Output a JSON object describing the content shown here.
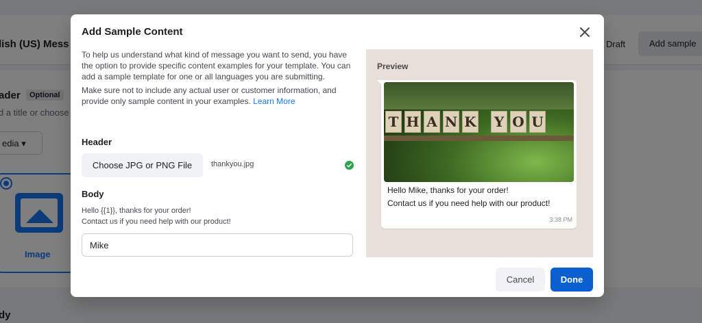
{
  "background": {
    "page_title": "lish (US) Mess",
    "draft_label": "Draft",
    "add_sample_label": "Add sample",
    "header_label": "ader",
    "optional_badge": "Optional",
    "header_hint": "d a title or choose",
    "media_dropdown": "edia",
    "image_option_label": "Image",
    "body_label": "dy"
  },
  "modal": {
    "title": "Add Sample Content",
    "intro": "To help us understand what kind of message you want to send, you have the option to provide specific content examples for your template. You can add a sample template for one or all languages you are submitting.",
    "notice": "Make sure not to include any actual user or customer information, and provide only sample content in your examples.",
    "learn_more": "Learn More",
    "header_section": {
      "label": "Header",
      "choose_button": "Choose JPG or PNG File",
      "file_name": "thankyou.jpg"
    },
    "body_section": {
      "label": "Body",
      "line1": "Hello {{1}}, thanks for your order!",
      "line2": "Contact us if you need help with our product!",
      "input_value": "Mike"
    },
    "preview": {
      "label": "Preview",
      "image_text": "THANK YOU",
      "message_line1": "Hello Mike, thanks for your order!",
      "message_line2": "Contact us if you need help with our product!",
      "time": "3:38 PM"
    },
    "buttons": {
      "cancel": "Cancel",
      "done": "Done"
    }
  },
  "colors": {
    "accent": "#1877f2",
    "done_button": "#0b5fce",
    "success": "#31a24c"
  }
}
